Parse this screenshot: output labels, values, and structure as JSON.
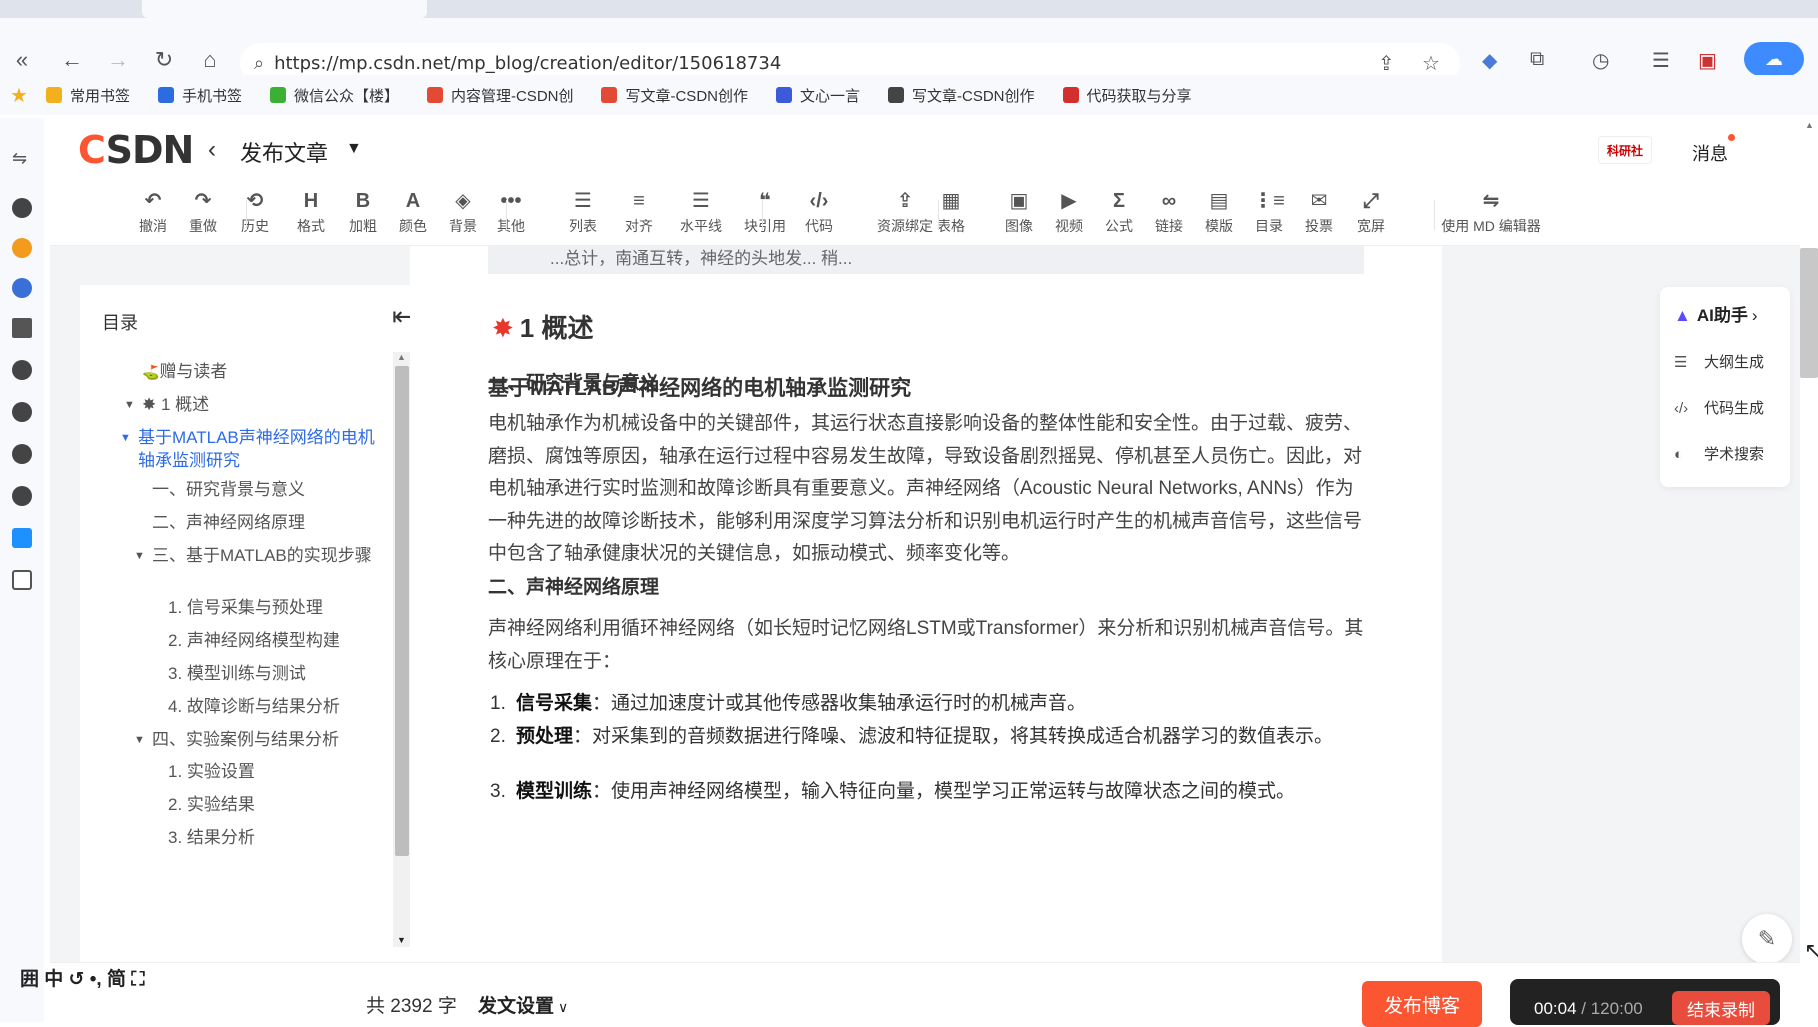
{
  "browser": {
    "url": "https://mp.csdn.net/mp_blog/creation/editor/150618734",
    "bookmarks": [
      {
        "label": "常用书签",
        "color": "#f2b01e"
      },
      {
        "label": "手机书签",
        "color": "#2b6de0"
      },
      {
        "label": "微信公众【楼】",
        "color": "#3cb034"
      },
      {
        "label": "内容管理-CSDN创",
        "color": "#e24a35"
      },
      {
        "label": "写文章-CSDN创作",
        "color": "#e24a35"
      },
      {
        "label": "文心一言",
        "color": "#3b5bdb"
      },
      {
        "label": "写文章-CSDN创作",
        "color": "#444444"
      },
      {
        "label": "代码获取与分享",
        "color": "#d32f2f"
      }
    ]
  },
  "header": {
    "logo": "CSDN",
    "title": "发布文章",
    "messages": "消息",
    "user_badge": "科研社"
  },
  "toolbar": {
    "items": [
      {
        "icon": "↶",
        "label": "撤消"
      },
      {
        "icon": "↷",
        "label": "重做"
      },
      {
        "icon": "⟲",
        "label": "历史"
      },
      {
        "icon": "H",
        "label": "格式"
      },
      {
        "icon": "B",
        "label": "加粗"
      },
      {
        "icon": "A",
        "label": "颜色"
      },
      {
        "icon": "◈",
        "label": "背景"
      },
      {
        "icon": "•••",
        "label": "其他"
      },
      {
        "icon": "☰",
        "label": "列表"
      },
      {
        "icon": "≡",
        "label": "对齐"
      },
      {
        "icon": "☰",
        "label": "水平线"
      },
      {
        "icon": "❝",
        "label": "块引用"
      },
      {
        "icon": "‹/›",
        "label": "代码"
      },
      {
        "icon": "⇪",
        "label": "资源绑定"
      },
      {
        "icon": "▦",
        "label": "表格"
      },
      {
        "icon": "▣",
        "label": "图像"
      },
      {
        "icon": "▶",
        "label": "视频"
      },
      {
        "icon": "Σ",
        "label": "公式"
      },
      {
        "icon": "∞",
        "label": "链接"
      },
      {
        "icon": "▤",
        "label": "模版"
      },
      {
        "icon": "⋮≡",
        "label": "目录"
      },
      {
        "icon": "✉",
        "label": "投票"
      },
      {
        "icon": "⤢",
        "label": "宽屏"
      },
      {
        "icon": "⇋",
        "label": "使用 MD 编辑器"
      }
    ]
  },
  "toc": {
    "title": "目录",
    "items": [
      {
        "label": "赠与读者",
        "level": 1
      },
      {
        "label": "✸ 1 概述",
        "level": 1
      },
      {
        "label": "基于MATLAB声神经网络的电机轴承监测研究",
        "level": 2
      },
      {
        "label": "一、研究背景与意义",
        "level": 3
      },
      {
        "label": "二、声神经网络原理",
        "level": 3
      },
      {
        "label": "三、基于MATLAB的实现步骤",
        "level": 3
      },
      {
        "label": "1. 信号采集与预处理",
        "level": 4
      },
      {
        "label": "2. 声神经网络模型构建",
        "level": 4
      },
      {
        "label": "3. 模型训练与测试",
        "level": 4
      },
      {
        "label": "4. 故障诊断与结果分析",
        "level": 4
      },
      {
        "label": "四、实验案例与结果分析",
        "level": 3
      },
      {
        "label": "1. 实验设置",
        "level": 4
      },
      {
        "label": "2. 实验结果",
        "level": 4
      },
      {
        "label": "3. 结果分析",
        "level": 4
      }
    ]
  },
  "article": {
    "quote_tail": "...总计，南通互转，神经的头地发... 稍...",
    "h1": "1 概述",
    "h2": "基于MATLAB声神经网络的电机轴承监测研究",
    "section1_title": "一、研究背景与意义",
    "section1_para": "电机轴承作为机械设备中的关键部件，其运行状态直接影响设备的整体性能和安全性。由于过载、疲劳、磨损、腐蚀等原因，轴承在运行过程中容易发生故障，导致设备剧烈摇晃、停机甚至人员伤亡。因此，对电机轴承进行实时监测和故障诊断具有重要意义。声神经网络（Acoustic Neural Networks, ANNs）作为一种先进的故障诊断技术，能够利用深度学习算法分析和识别电机运行时产生的机械声音信号，这些信号中包含了轴承健康状况的关键信息，如振动模式、频率变化等。",
    "section2_title": "二、声神经网络原理",
    "section2_para": "声神经网络利用循环神经网络（如长短时记忆网络LSTM或Transformer）来分析和识别机械声音信号。其核心原理在于：",
    "list": [
      {
        "num": "1.",
        "bold": "信号采集",
        "text": "：通过加速度计或其他传感器收集轴承运行时的机械声音。"
      },
      {
        "num": "2.",
        "bold": "预处理",
        "text": "：对采集到的音频数据进行降噪、滤波和特征提取，将其转换成适合机器学习的数值表示。"
      },
      {
        "num": "3.",
        "bold": "模型训练",
        "text": "：使用声神经网络模型，输入特征向量，模型学习正常运转与故障状态之间的模式。"
      }
    ]
  },
  "ai_panel": {
    "title": "AI助手",
    "items": [
      {
        "icon": "☰",
        "label": "大纲生成"
      },
      {
        "icon": "‹/›",
        "label": "代码生成"
      },
      {
        "icon": "◐",
        "label": "学术搜索"
      }
    ]
  },
  "footer": {
    "word_count": "共 2392 字",
    "publish_settings": "发文设置",
    "publish": "发布博客"
  },
  "recorder": {
    "elapsed": "00:04",
    "total": "/ 120:00",
    "stop": "结束录制"
  },
  "ime": "囲 中 ↺ •, 简 ⛶",
  "colors": {
    "accent": "#fc5531",
    "link": "#2e6be6"
  }
}
